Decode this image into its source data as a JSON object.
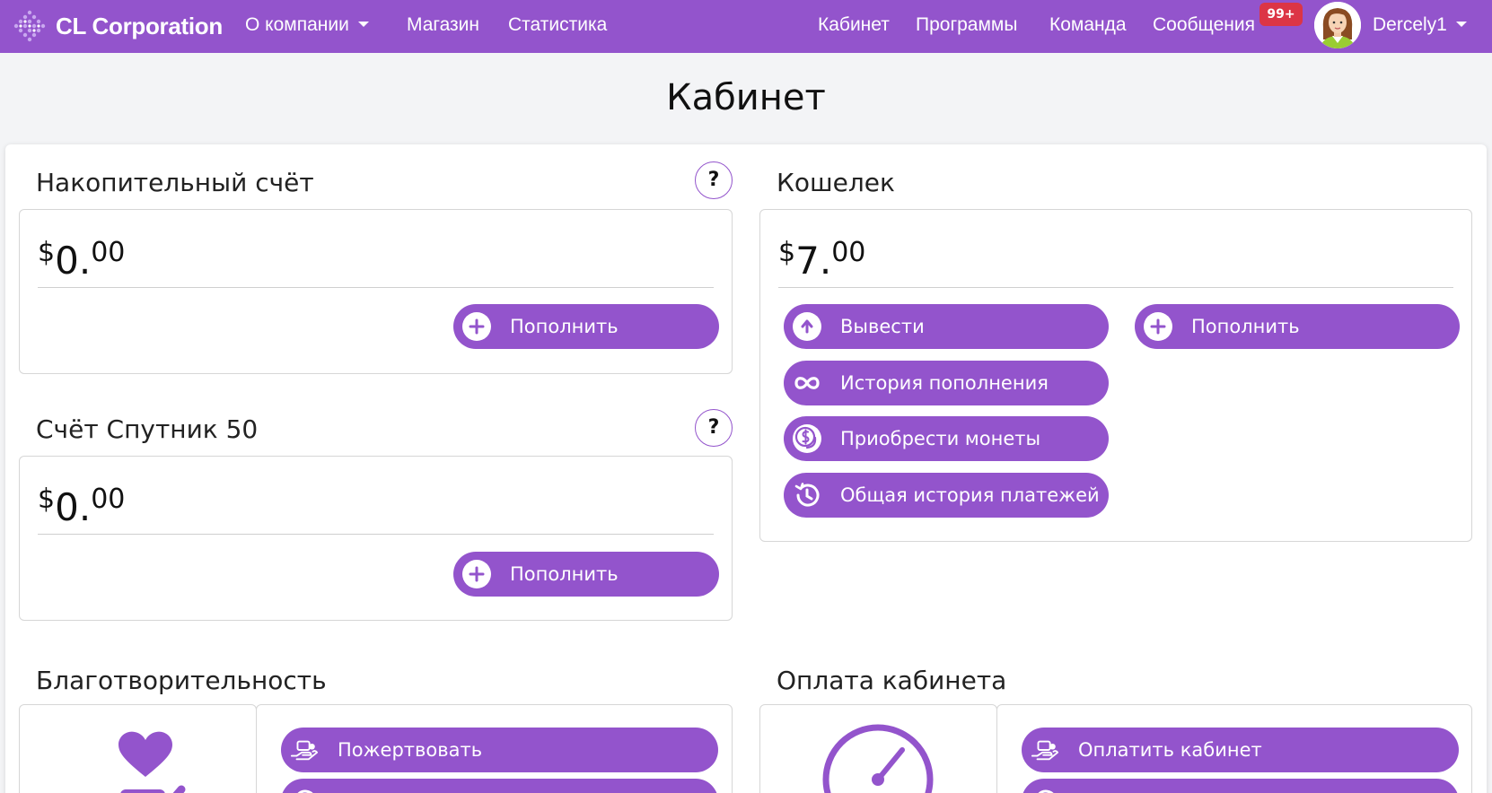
{
  "navbar": {
    "brand": "CL Corporation",
    "left_links": [
      {
        "label": "О компании"
      },
      {
        "label": "Магазин"
      },
      {
        "label": "Статистика"
      }
    ],
    "right_links": [
      {
        "label": "Кабинет"
      },
      {
        "label": "Программы"
      },
      {
        "label": "Команда"
      },
      {
        "label": "Сообщения"
      }
    ],
    "messages_badge": "99+",
    "username": "Dercely1"
  },
  "page": {
    "title": "Кабинет"
  },
  "savings": {
    "title": "Накопительный счёт",
    "help": "?",
    "currency": "$",
    "amount_int": "0",
    "amount_sep": ".",
    "amount_dec": "00",
    "topup_label": "Пополнить"
  },
  "sputnik": {
    "title": "Счёт Спутник 50",
    "help": "?",
    "currency": "$",
    "amount_int": "0",
    "amount_sep": ".",
    "amount_dec": "00",
    "topup_label": "Пополнить"
  },
  "wallet": {
    "title": "Кошелек",
    "currency": "$",
    "amount_int": "7",
    "amount_sep": ".",
    "amount_dec": "00",
    "withdraw_label": "Вывести",
    "topup_label": "Пополнить",
    "history_label": "История пополнения",
    "coins_label": "Приобрести монеты",
    "payments_label": "Общая история платежей"
  },
  "charity": {
    "title": "Благотворительность",
    "donate_label": "Пожертвовать"
  },
  "cabinet_payment": {
    "title": "Оплата кабинета",
    "pay_label": "Оплатить кабинет"
  },
  "colors": {
    "accent": "#9354cc",
    "badge": "#dc3545",
    "background": "#f3f4f6"
  }
}
